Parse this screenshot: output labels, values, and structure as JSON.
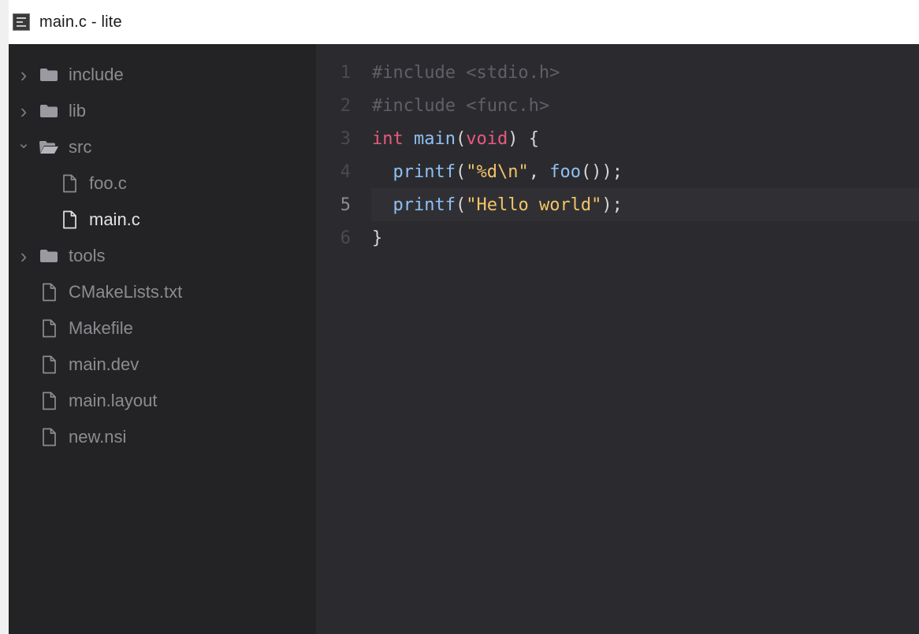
{
  "window": {
    "title": "main.c - lite"
  },
  "colors": {
    "sidebar_bg": "#232326",
    "editor_bg": "#2b2b2f",
    "keyword": "#e85a80",
    "function": "#8fc0f3",
    "string": "#f2c467",
    "preprocessor": "#5f5f66"
  },
  "tree": [
    {
      "label": "include",
      "type": "folder",
      "expanded": false,
      "depth": 0,
      "icon": "folder-icon"
    },
    {
      "label": "lib",
      "type": "folder",
      "expanded": false,
      "depth": 0,
      "icon": "folder-icon"
    },
    {
      "label": "src",
      "type": "folder",
      "expanded": true,
      "depth": 0,
      "icon": "folder-open-icon"
    },
    {
      "label": "foo.c",
      "type": "file",
      "depth": 1,
      "icon": "file-icon"
    },
    {
      "label": "main.c",
      "type": "file",
      "depth": 1,
      "icon": "file-icon",
      "active": true
    },
    {
      "label": "tools",
      "type": "folder",
      "expanded": false,
      "depth": 0,
      "icon": "folder-icon"
    },
    {
      "label": "CMakeLists.txt",
      "type": "file",
      "depth": 0,
      "icon": "file-icon"
    },
    {
      "label": "Makefile",
      "type": "file",
      "depth": 0,
      "icon": "file-icon"
    },
    {
      "label": "main.dev",
      "type": "file",
      "depth": 0,
      "icon": "file-icon"
    },
    {
      "label": "main.layout",
      "type": "file",
      "depth": 0,
      "icon": "file-icon"
    },
    {
      "label": "new.nsi",
      "type": "file",
      "depth": 0,
      "icon": "file-icon"
    }
  ],
  "editor": {
    "current_line": 5,
    "lines": [
      {
        "num": "1",
        "tokens": [
          {
            "t": "#include <stdio.h>",
            "k": "pre"
          }
        ]
      },
      {
        "num": "2",
        "tokens": [
          {
            "t": "#include <func.h>",
            "k": "pre"
          }
        ]
      },
      {
        "num": "3",
        "tokens": [
          {
            "t": "int",
            "k": "kw"
          },
          {
            "t": " ",
            "k": "pun"
          },
          {
            "t": "main",
            "k": "fn"
          },
          {
            "t": "(",
            "k": "pun"
          },
          {
            "t": "void",
            "k": "kw"
          },
          {
            "t": ") {",
            "k": "pun"
          }
        ]
      },
      {
        "num": "4",
        "tokens": [
          {
            "t": "  ",
            "k": "pun"
          },
          {
            "t": "printf",
            "k": "fn"
          },
          {
            "t": "(",
            "k": "pun"
          },
          {
            "t": "\"%d\\n\"",
            "k": "str"
          },
          {
            "t": ", ",
            "k": "pun"
          },
          {
            "t": "foo",
            "k": "fn"
          },
          {
            "t": "());",
            "k": "pun"
          }
        ]
      },
      {
        "num": "5",
        "tokens": [
          {
            "t": "  ",
            "k": "pun"
          },
          {
            "t": "printf",
            "k": "fn"
          },
          {
            "t": "(",
            "k": "pun"
          },
          {
            "t": "\"Hello world\"",
            "k": "str"
          },
          {
            "t": ");",
            "k": "pun"
          }
        ]
      },
      {
        "num": "6",
        "tokens": [
          {
            "t": "}",
            "k": "pun"
          }
        ]
      }
    ]
  }
}
